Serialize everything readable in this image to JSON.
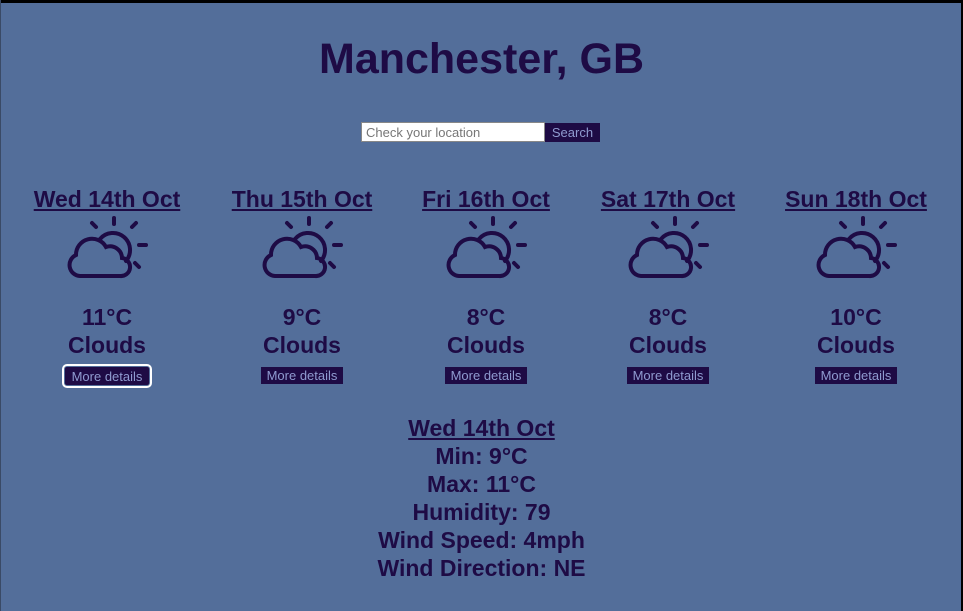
{
  "header": {
    "title": "Manchester, GB"
  },
  "search": {
    "placeholder": "Check your location",
    "button_label": "Search"
  },
  "forecast": [
    {
      "date": "Wed 14th Oct",
      "temp": "11°C",
      "desc": "Clouds",
      "icon": "partly-cloudy-icon",
      "button_label": "More details"
    },
    {
      "date": "Thu 15th Oct",
      "temp": "9°C",
      "desc": "Clouds",
      "icon": "partly-cloudy-icon",
      "button_label": "More details"
    },
    {
      "date": "Fri 16th Oct",
      "temp": "8°C",
      "desc": "Clouds",
      "icon": "partly-cloudy-icon",
      "button_label": "More details"
    },
    {
      "date": "Sat 17th Oct",
      "temp": "8°C",
      "desc": "Clouds",
      "icon": "partly-cloudy-icon",
      "button_label": "More details"
    },
    {
      "date": "Sun 18th Oct",
      "temp": "10°C",
      "desc": "Clouds",
      "icon": "partly-cloudy-icon",
      "button_label": "More details"
    }
  ],
  "details": {
    "date": "Wed 14th Oct",
    "min": "Min: 9°C",
    "max": "Max: 11°C",
    "humidity": "Humidity: 79",
    "wind_speed": "Wind Speed: 4mph",
    "wind_direction": "Wind Direction: NE"
  },
  "colors": {
    "background": "#536e9a",
    "text": "#1e0b45",
    "button_bg": "#1e0b45",
    "button_text": "#8f9bd0"
  }
}
